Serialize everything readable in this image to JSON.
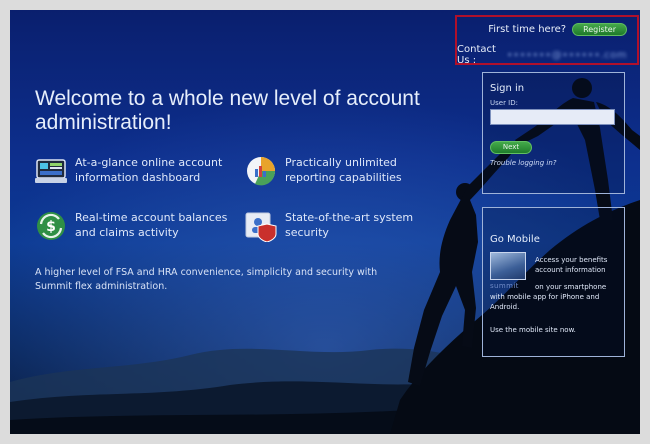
{
  "header": {
    "first_time": "First time here?",
    "register_label": "Register",
    "contact_label": "Contact Us :",
    "contact_value": "•••••••@••••••.com",
    "highlight_color": "#b0102b"
  },
  "hero": {
    "title": "Welcome to a whole new level of account administration!",
    "features": [
      {
        "icon": "dashboard-icon",
        "text": "At-a-glance online account information dashboard"
      },
      {
        "icon": "reporting-chart-icon",
        "text": "Practically unlimited reporting capabilities"
      },
      {
        "icon": "dollar-refresh-icon",
        "text": "Real-time account balances and claims activity"
      },
      {
        "icon": "security-shield-icon",
        "text": "State-of-the-art system security"
      }
    ],
    "tagline": "A higher level of FSA and HRA convenience, simplicity and security with Summit flex administration."
  },
  "signin": {
    "title": "Sign in",
    "user_id_label": "User ID:",
    "user_id_value": "",
    "next_label": "Next",
    "trouble_label": "Trouble logging in?",
    "button_color": "#2f8f38"
  },
  "mobile": {
    "title": "Go Mobile",
    "line1": "Access your benefits",
    "line2": "account information",
    "brand": "summit",
    "line3": "on your smartphone",
    "line4": "with mobile app for iPhone and Android.",
    "mobile_site": "Use the mobile site now."
  }
}
